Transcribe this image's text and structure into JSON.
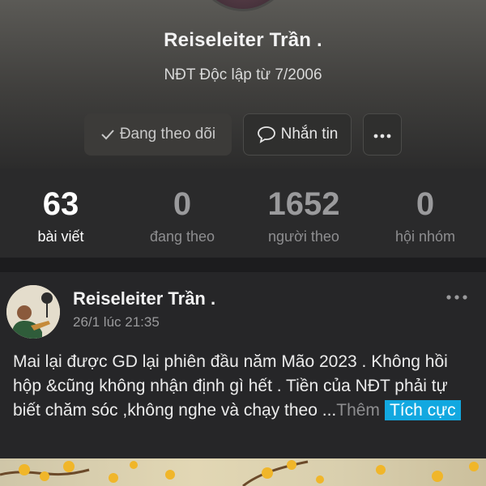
{
  "profile": {
    "name": "Reiseleiter Trần .",
    "bio": "NĐT Độc lập từ 7/2006"
  },
  "actions": {
    "following_label": "Đang theo dõi",
    "message_label": "Nhắn tin"
  },
  "stats": [
    {
      "value": "63",
      "label": "bài viết"
    },
    {
      "value": "0",
      "label": "đang theo"
    },
    {
      "value": "1652",
      "label": "người theo"
    },
    {
      "value": "0",
      "label": "hội nhóm"
    }
  ],
  "post": {
    "author": "Reiseleiter Trần .",
    "time": "26/1 lúc 21:35",
    "text": "Mai lại được GD lại phiên đầu năm Mão 2023 . Không hồi hộp &cũng không nhận định gì hết . Tiền của NĐT phải tự biết chăm sóc ,không nghe và chạy theo ...",
    "see_more": "Thêm",
    "tag": "Tích cực"
  },
  "colors": {
    "background": "#1c1c1e",
    "tag": "#12a8e0"
  },
  "icons": [
    "checkmark-icon",
    "chat-bubble-icon",
    "more-dots-icon"
  ]
}
